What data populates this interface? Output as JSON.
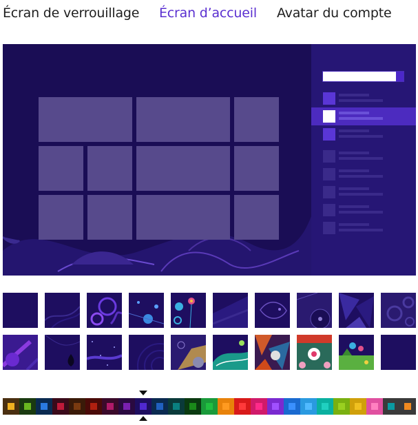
{
  "tabs": [
    {
      "label": "Écran de verrouillage",
      "active": false
    },
    {
      "label": "Écran d’accueil",
      "active": true
    },
    {
      "label": "Avatar du compte",
      "active": false
    }
  ],
  "colors": {
    "accent": "#5a2fd0",
    "preview_bg": "#1a0d55",
    "sidebar_bg": "#261675",
    "tile": "#574a8c"
  },
  "sidebar_items": [
    {
      "icon_color": "#5a36d6",
      "selected": false
    },
    {
      "icon_color": "#ffffff",
      "selected": true
    },
    {
      "icon_color": "#5a36d6",
      "selected": false
    },
    {
      "icon_color": "#3a2a8a",
      "selected": false
    },
    {
      "icon_color": "#3a2a8a",
      "selected": false
    },
    {
      "icon_color": "#3a2a8a",
      "selected": false
    },
    {
      "icon_color": "#3a2a8a",
      "selected": false
    },
    {
      "icon_color": "#3a2a8a",
      "selected": false
    }
  ],
  "patterns": [
    {
      "name": "frame",
      "selected": true
    },
    {
      "name": "curves"
    },
    {
      "name": "swirls"
    },
    {
      "name": "flowers-blue"
    },
    {
      "name": "dandelions"
    },
    {
      "name": "waves"
    },
    {
      "name": "fish-sketch"
    },
    {
      "name": "vinyl"
    },
    {
      "name": "triangles"
    },
    {
      "name": "gears"
    },
    {
      "name": "guitar"
    },
    {
      "name": "raindrop-leaf"
    },
    {
      "name": "stars"
    },
    {
      "name": "circles"
    },
    {
      "name": "trumpet"
    },
    {
      "name": "splash"
    },
    {
      "name": "graffiti"
    },
    {
      "name": "folk-flowers"
    },
    {
      "name": "landscape"
    },
    {
      "name": "plain"
    }
  ],
  "swatches": [
    {
      "bg": "#4a2f10",
      "dot": "#f0b020"
    },
    {
      "bg": "#1a3a10",
      "dot": "#6ab820"
    },
    {
      "bg": "#0a2a50",
      "dot": "#2a7ae0"
    },
    {
      "bg": "#3a0a1a",
      "dot": "#c01a3a"
    },
    {
      "bg": "#3a1a08",
      "dot": "#7a3a10"
    },
    {
      "bg": "#4a0a08",
      "dot": "#b02010"
    },
    {
      "bg": "#3a0a2a",
      "dot": "#b01a6a"
    },
    {
      "bg": "#2a0a40",
      "dot": "#7a20b0"
    },
    {
      "bg": "#1e0e60",
      "dot": "#5028d0",
      "selected": true
    },
    {
      "bg": "#0a2a50",
      "dot": "#2060c0"
    },
    {
      "bg": "#0a3a3a",
      "dot": "#0a8080"
    },
    {
      "bg": "#0a3a10",
      "dot": "#1a8a1a"
    },
    {
      "bg": "#1a9a3a",
      "dot": "#20c040"
    },
    {
      "bg": "#e8820a",
      "dot": "#ff9a20"
    },
    {
      "bg": "#d81a1a",
      "dot": "#ff3a3a"
    },
    {
      "bg": "#d01a6a",
      "dot": "#ff2a8a"
    },
    {
      "bg": "#7a2ad0",
      "dot": "#a050ff"
    },
    {
      "bg": "#1a6ad0",
      "dot": "#3a90ff"
    },
    {
      "bg": "#2a9ae0",
      "dot": "#50baff"
    },
    {
      "bg": "#0ab0a0",
      "dot": "#20d0c0"
    },
    {
      "bg": "#7ab010",
      "dot": "#9ad020"
    },
    {
      "bg": "#d0a00a",
      "dot": "#f0c020"
    },
    {
      "bg": "#e050a0",
      "dot": "#ff80c0"
    },
    {
      "bg": "#3a3a3a",
      "dot": "#0a9aa0"
    },
    {
      "bg": "#3a3a3a",
      "dot": "#f08a20"
    }
  ]
}
